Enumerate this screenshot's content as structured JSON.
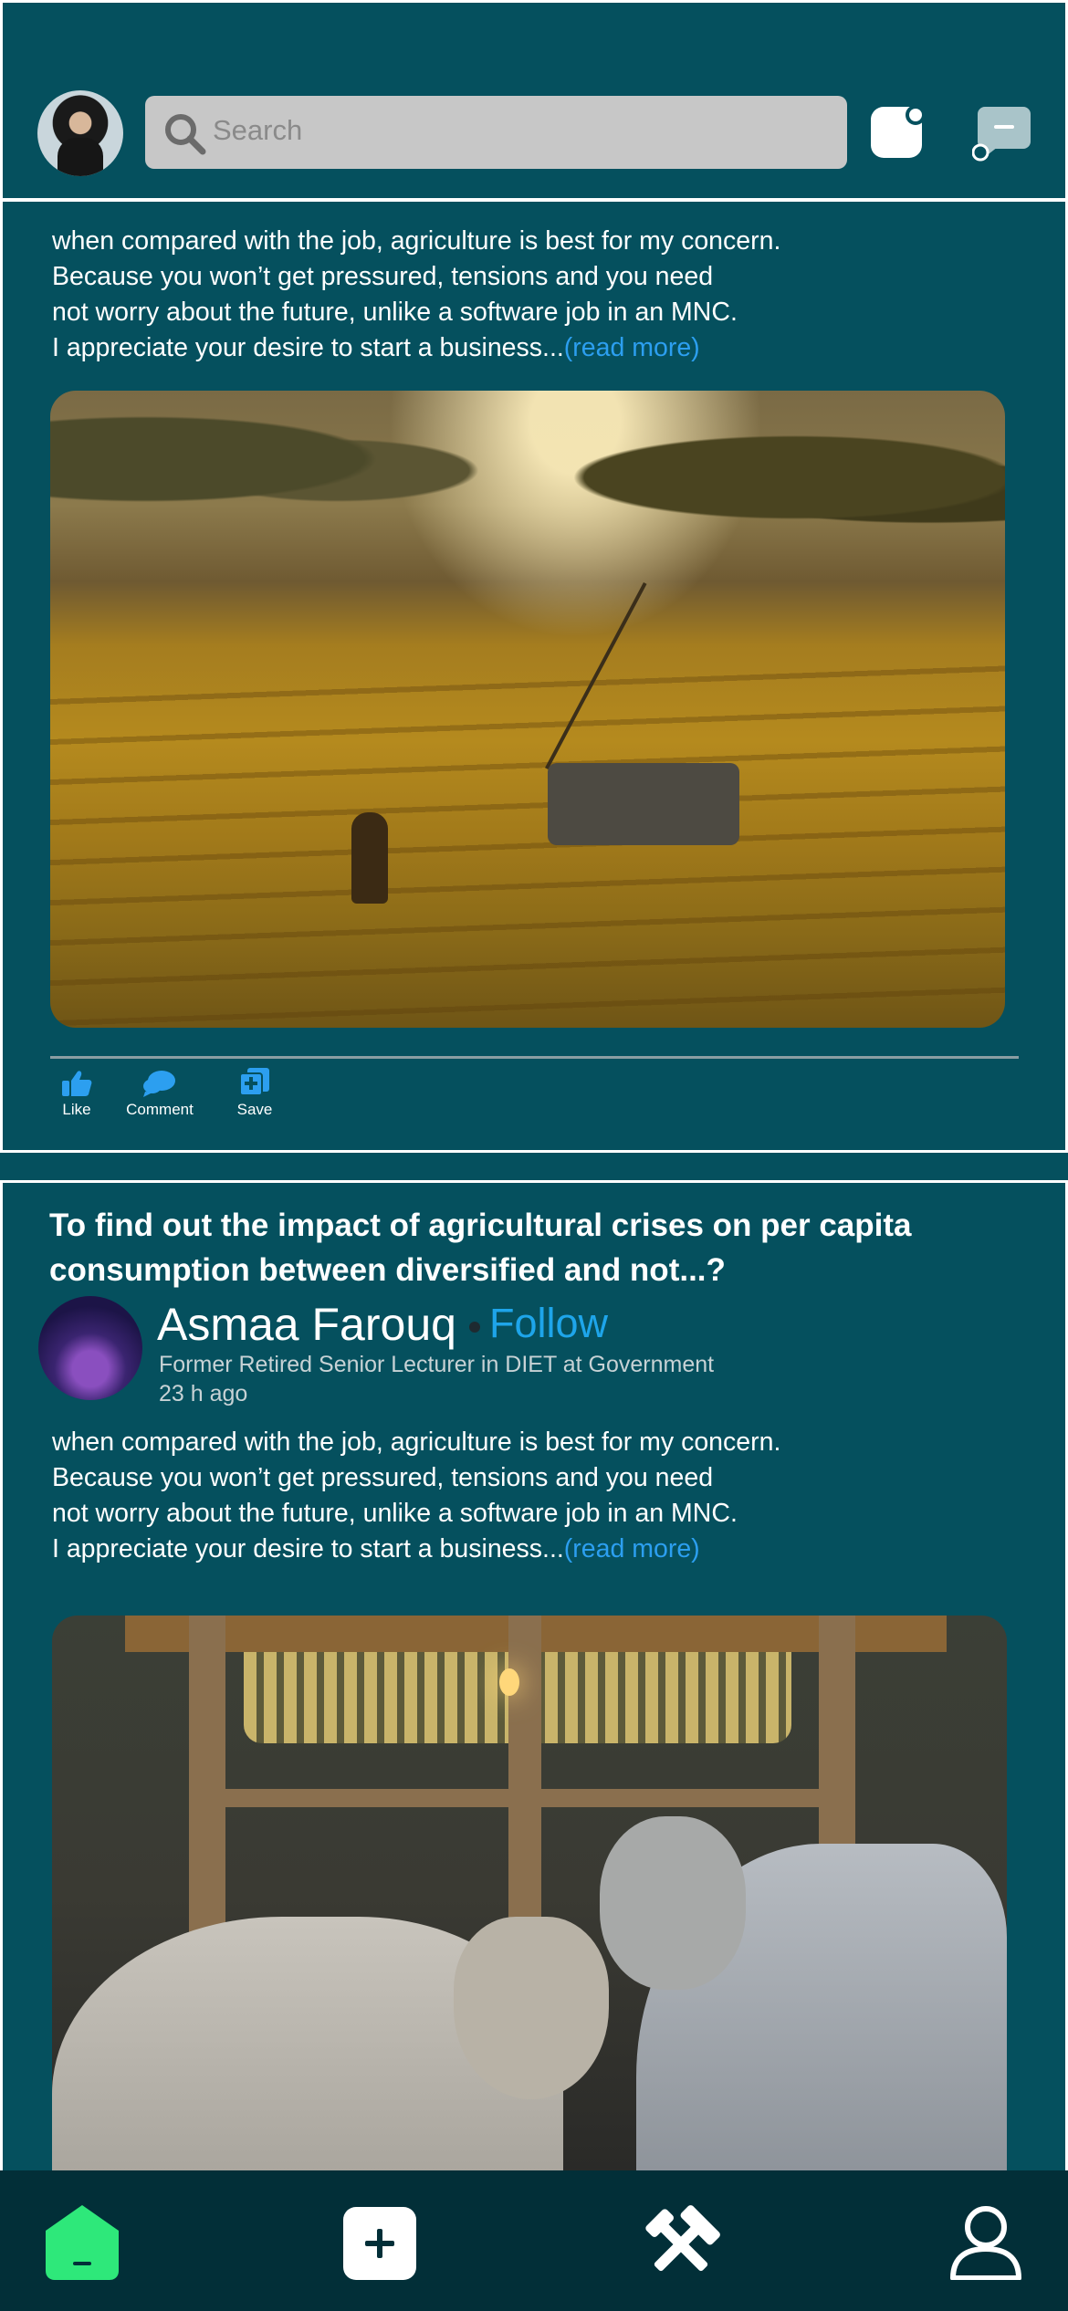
{
  "header": {
    "search_placeholder": "Search"
  },
  "post1": {
    "text": "when compared with the job, agriculture is best for my concern.\nBecause you won’t get pressured, tensions and you need\nnot worry about the future, unlike a software job in an MNC.\nI appreciate your desire to start a business...",
    "read_more": "(read more)",
    "actions": {
      "like": "Like",
      "comment": "Comment",
      "save": "Save"
    }
  },
  "post2": {
    "question": "To find out the impact of agricultural crises on per capita consumption between diversified and not...?",
    "author": {
      "name": "Asmaa Farouq",
      "follow": "Follow",
      "role": "Former Retired Senior Lecturer in DIET at Government",
      "time": "23 h ago"
    },
    "text": "when compared with the job, agriculture is best for my concern.\nBecause you won’t get pressured, tensions and you need\nnot worry about the future, unlike a software job in an MNC.\nI appreciate your desire to start a business...",
    "read_more": "(read more)"
  },
  "colors": {
    "background": "#05505E",
    "bottom_nav": "#022F38",
    "link": "#2c9ff0",
    "follow": "#1ea5ea",
    "home_active": "#2ee87a"
  },
  "bottom_nav": {
    "items": [
      "home-icon",
      "add-icon",
      "tools-icon",
      "profile-icon"
    ]
  }
}
